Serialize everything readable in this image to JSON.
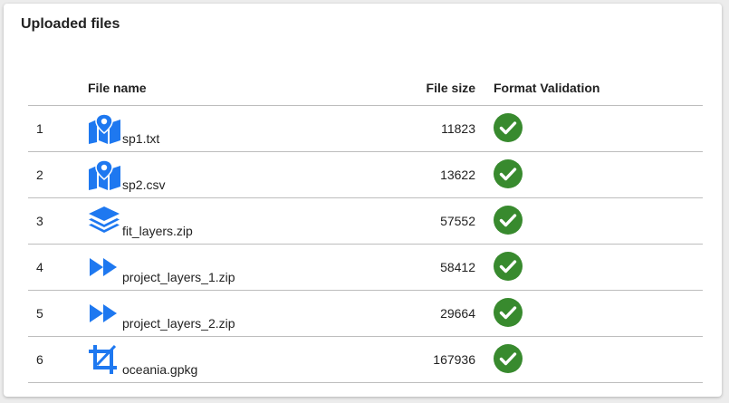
{
  "panel": {
    "title": "Uploaded files"
  },
  "table": {
    "headers": {
      "index": "",
      "name": "File name",
      "size": "File size",
      "validation": "Format Validation"
    },
    "rows": [
      {
        "index": "1",
        "icon": "map-icon",
        "name": "sp1.txt",
        "size": "11823",
        "valid": "check-circle-icon"
      },
      {
        "index": "2",
        "icon": "map-icon",
        "name": "sp2.csv",
        "size": "13622",
        "valid": "check-circle-icon"
      },
      {
        "index": "3",
        "icon": "layers-icon",
        "name": "fit_layers.zip",
        "size": "57552",
        "valid": "check-circle-icon"
      },
      {
        "index": "4",
        "icon": "fast-forward-icon",
        "name": "project_layers_1.zip",
        "size": "58412",
        "valid": "check-circle-icon"
      },
      {
        "index": "5",
        "icon": "fast-forward-icon",
        "name": "project_layers_2.zip",
        "size": "29664",
        "valid": "check-circle-icon"
      },
      {
        "index": "6",
        "icon": "crop-icon",
        "name": "oceania.gpkg",
        "size": "167936",
        "valid": "check-circle-icon"
      }
    ]
  },
  "colors": {
    "icon_blue": "#1e78f0",
    "check_green": "#388a2e",
    "divider": "#bdbdbd"
  }
}
